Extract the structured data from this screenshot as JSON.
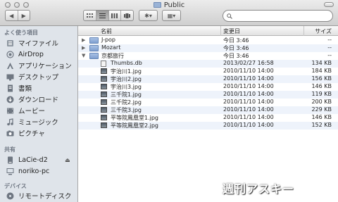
{
  "window": {
    "title": "Public"
  },
  "toolbar": {
    "back_label": "◀",
    "forward_label": "▶",
    "view_modes": [
      "icon-view-icon",
      "list-view-icon",
      "column-view-icon",
      "coverflow-view-icon"
    ],
    "action_label": "✱▾",
    "arrange_label": "▦▾",
    "search": {
      "value": "",
      "placeholder": ""
    }
  },
  "sidebar": {
    "favorites_heading": "よく使う項目",
    "favorites": [
      {
        "label": "マイファイル",
        "icon": "all-my-files-icon"
      },
      {
        "label": "AirDrop",
        "icon": "airdrop-icon"
      },
      {
        "label": "アプリケーション",
        "icon": "applications-icon"
      },
      {
        "label": "デスクトップ",
        "icon": "desktop-icon"
      },
      {
        "label": "書類",
        "icon": "documents-icon"
      },
      {
        "label": "ダウンロード",
        "icon": "downloads-icon"
      },
      {
        "label": "ムービー",
        "icon": "movies-icon"
      },
      {
        "label": "ミュージック",
        "icon": "music-icon"
      },
      {
        "label": "ピクチャ",
        "icon": "pictures-icon"
      }
    ],
    "shared_heading": "共有",
    "shared": [
      {
        "label": "LaCie-d2",
        "icon": "drive-icon"
      },
      {
        "label": "noriko-pc",
        "icon": "pc-icon"
      }
    ],
    "devices_heading": "デバイス",
    "devices": [
      {
        "label": "リモートディスク",
        "icon": "remote-disc-icon"
      }
    ]
  },
  "columns": {
    "name": "名前",
    "date": "変更日",
    "size": "サイズ"
  },
  "rows": [
    {
      "name": "J-pop",
      "date": "今日 3:46",
      "size": "--",
      "kind": "folder",
      "expanded": false
    },
    {
      "name": "Mozart",
      "date": "今日 3:46",
      "size": "--",
      "kind": "folder",
      "expanded": false
    },
    {
      "name": "京都旅行",
      "date": "今日 3:46",
      "size": "--",
      "kind": "folder",
      "expanded": true
    },
    {
      "name": "Thumbs.db",
      "date": "2013/02/27 16:58",
      "size": "134 KB",
      "kind": "file"
    },
    {
      "name": "宇治川1.jpg",
      "date": "2010/11/10 14:00",
      "size": "184 KB",
      "kind": "image"
    },
    {
      "name": "宇治川2.jpg",
      "date": "2010/11/10 14:00",
      "size": "156 KB",
      "kind": "image"
    },
    {
      "name": "宇治川3.jpg",
      "date": "2010/11/10 14:00",
      "size": "146 KB",
      "kind": "image"
    },
    {
      "name": "三千院1.jpg",
      "date": "2010/11/10 14:00",
      "size": "119 KB",
      "kind": "image"
    },
    {
      "name": "三千院2.jpg",
      "date": "2010/11/10 14:00",
      "size": "200 KB",
      "kind": "image"
    },
    {
      "name": "三千院3.jpg",
      "date": "2010/11/10 14:00",
      "size": "229 KB",
      "kind": "image"
    },
    {
      "name": "平等院鳳凰堂1.jpg",
      "date": "2010/11/10 14:00",
      "size": "146 KB",
      "kind": "image"
    },
    {
      "name": "平等院鳳凰堂2.jpg",
      "date": "2010/11/10 14:00",
      "size": "152 KB",
      "kind": "image"
    }
  ],
  "watermark": "週刊アスキー"
}
